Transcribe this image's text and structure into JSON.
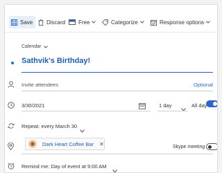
{
  "toolbar": {
    "save_label": "Save",
    "discard_label": "Discard",
    "free_label": "Free",
    "categorize_label": "Categorize",
    "response_options_label": "Response options",
    "more_label": "···"
  },
  "event": {
    "calendar_label": "Calendar",
    "title": "Sathvik's Birthday!",
    "attendees_placeholder": "Invite attendees",
    "optional_link": "Optional",
    "date": "3/30/2021",
    "duration": "1 day",
    "all_day_label": "All day",
    "all_day_enabled": true,
    "repeat_label": "Repeat: every March 30",
    "location": "Dark Heart Coffee Bar",
    "skype_meeting_label": "Skype meeting",
    "skype_meeting_enabled": false,
    "reminder_label": "Remind me: Day of event at 9:00 AM"
  },
  "colors": {
    "accent": "#2a67c8",
    "title": "#1f5fb8",
    "save_highlight": "#e6eef8"
  },
  "icons": [
    "save-icon",
    "trash-icon",
    "free-busy-icon",
    "tag-icon",
    "calendar-check-icon",
    "person-icon",
    "clock-icon",
    "calendar-icon",
    "repeat-icon",
    "location-pin-icon",
    "alarm-icon"
  ]
}
